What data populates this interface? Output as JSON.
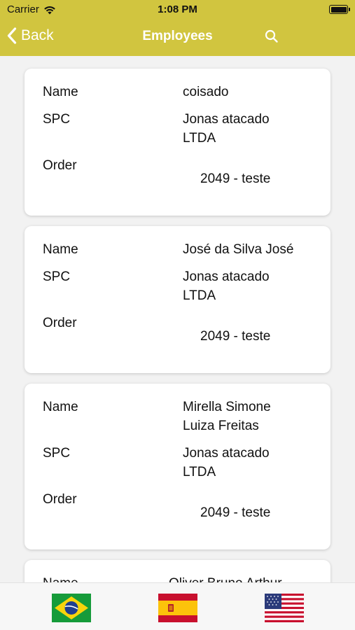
{
  "status_bar": {
    "carrier": "Carrier",
    "time": "1:08 PM"
  },
  "nav": {
    "back_label": "Back",
    "title": "Employees"
  },
  "labels": {
    "name": "Name",
    "spc": "SPC",
    "order": "Order"
  },
  "employees": [
    {
      "name_line1": "coisado",
      "name_line2": "",
      "spc_line1": "Jonas atacado",
      "spc_line2": "LTDA",
      "order": "2049 - teste"
    },
    {
      "name_line1": "José da Silva José",
      "name_line2": "",
      "spc_line1": "Jonas atacado",
      "spc_line2": "LTDA",
      "order": "2049 - teste"
    },
    {
      "name_line1": "Mirella Simone",
      "name_line2": "Luiza Freitas",
      "spc_line1": "Jonas atacado",
      "spc_line2": "LTDA",
      "order": "2049 - teste"
    },
    {
      "name_line1": "Oliver Bruno Arthur"
    }
  ],
  "languages": [
    {
      "icon": "brazil-flag-icon"
    },
    {
      "icon": "spain-flag-icon"
    },
    {
      "icon": "usa-flag-icon"
    }
  ],
  "colors": {
    "header": "#d1c53f",
    "background": "#f2f2f2",
    "card": "#ffffff"
  }
}
